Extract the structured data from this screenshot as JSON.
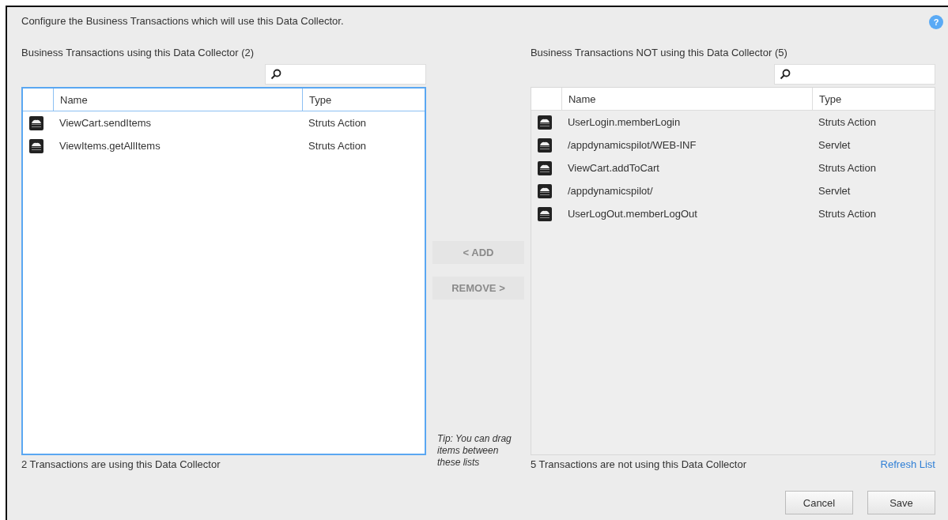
{
  "intro": "Configure the Business Transactions which will use this Data Collector.",
  "help": {
    "label": "?"
  },
  "left": {
    "title": "Business Transactions using this Data Collector (2)",
    "focused": true,
    "columns": [
      "Name",
      "Type"
    ],
    "rows": [
      {
        "name": "ViewCart.sendItems",
        "type": "Struts Action"
      },
      {
        "name": "ViewItems.getAllItems",
        "type": "Struts Action"
      }
    ],
    "footer": "2 Transactions are using this Data Collector"
  },
  "actions": [
    {
      "label": "< ADD",
      "disabled": true
    },
    {
      "label": "REMOVE >",
      "disabled": true
    }
  ],
  "tip": "Tip: You can drag items between these lists",
  "right": {
    "title": "Business Transactions NOT using this Data Collector (5)",
    "focused": false,
    "columns": [
      "Name",
      "Type"
    ],
    "rows": [
      {
        "name": "UserLogin.memberLogin",
        "type": "Struts Action"
      },
      {
        "name": "/appdynamicspilot/WEB-INF",
        "type": "Servlet"
      },
      {
        "name": "ViewCart.addToCart",
        "type": "Struts Action"
      },
      {
        "name": "/appdynamicspilot/",
        "type": "Servlet"
      },
      {
        "name": "UserLogOut.memberLogOut",
        "type": "Struts Action"
      }
    ],
    "footer": "5 Transactions are not using this Data Collector",
    "link": "Refresh List"
  },
  "buttons": [
    "Cancel",
    "Save"
  ]
}
